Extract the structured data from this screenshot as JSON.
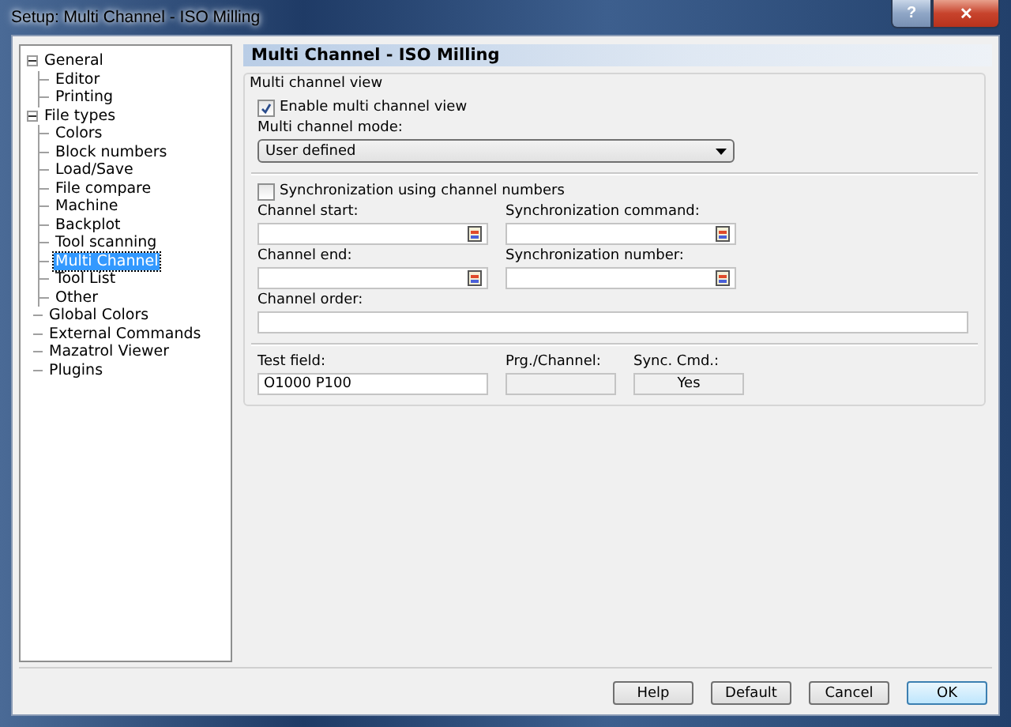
{
  "window": {
    "title": "Setup: Multi Channel - ISO Milling",
    "help_button": "?",
    "close_button": "✕"
  },
  "tree": [
    {
      "label": "General",
      "expanded": true,
      "selected": false,
      "children": [
        {
          "label": "Editor",
          "selected": false
        },
        {
          "label": "Printing",
          "selected": false
        }
      ]
    },
    {
      "label": "File types",
      "expanded": true,
      "selected": false,
      "children": [
        {
          "label": "Colors",
          "selected": false
        },
        {
          "label": "Block numbers",
          "selected": false
        },
        {
          "label": "Load/Save",
          "selected": false
        },
        {
          "label": "File compare",
          "selected": false
        },
        {
          "label": "Machine",
          "selected": false
        },
        {
          "label": "Backplot",
          "selected": false
        },
        {
          "label": "Tool scanning",
          "selected": false
        },
        {
          "label": "Multi Channel",
          "selected": true
        },
        {
          "label": "Tool List",
          "selected": false
        },
        {
          "label": "Other",
          "selected": false
        }
      ]
    },
    {
      "label": "Global Colors",
      "selected": false
    },
    {
      "label": "External Commands",
      "selected": false
    },
    {
      "label": "Mazatrol Viewer",
      "selected": false
    },
    {
      "label": "Plugins",
      "selected": false
    }
  ],
  "panel": {
    "title": "Multi Channel - ISO Milling",
    "group": "Multi channel view",
    "enable": {
      "label": "Enable multi channel view",
      "checked": true
    },
    "mode": {
      "label": "Multi channel mode:",
      "value": "User defined"
    },
    "sync": {
      "label": "Synchronization using channel numbers",
      "checked": false
    },
    "channel_start": {
      "label": "Channel start:"
    },
    "sync_command": {
      "label": "Synchronization command:"
    },
    "channel_end": {
      "label": "Channel end:"
    },
    "sync_number": {
      "label": "Synchronization number:"
    },
    "channel_order": {
      "label": "Channel order:"
    },
    "test_field": {
      "label": "Test field:",
      "value": "O1000 P100"
    },
    "prg_channel": {
      "label": "Prg./Channel:"
    },
    "sync_cmd": {
      "label": "Sync. Cmd.:",
      "value": "Yes"
    }
  },
  "buttons": [
    {
      "label": "Help",
      "default": false
    },
    {
      "label": "Default",
      "default": false
    },
    {
      "label": "Cancel",
      "default": false
    },
    {
      "label": "OK",
      "default": true
    }
  ]
}
